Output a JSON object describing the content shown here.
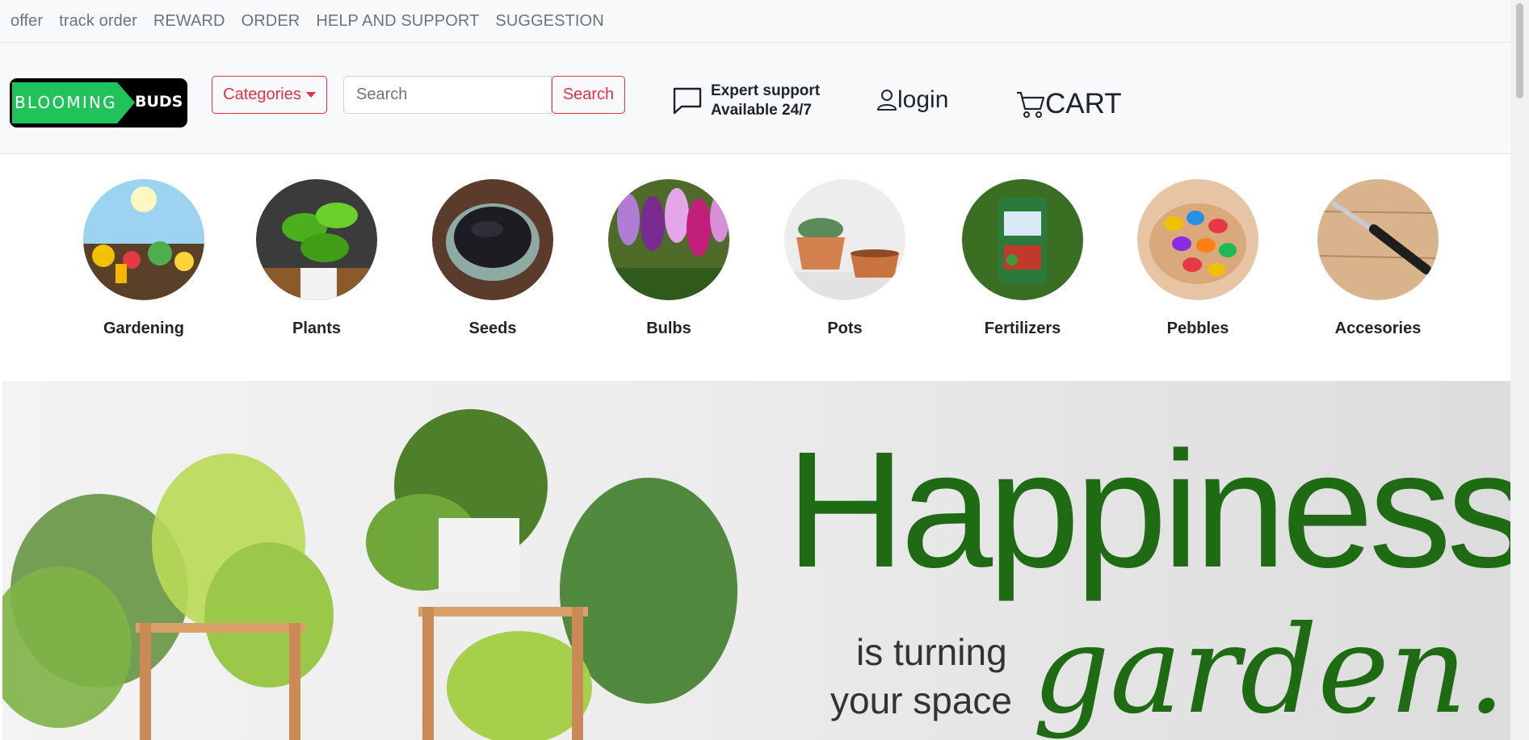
{
  "topnav": {
    "links": [
      "offer",
      "track order",
      "REWARD",
      "ORDER",
      "HELP AND SUPPORT",
      "SUGGESTION"
    ]
  },
  "logo": {
    "word1": "BLOOMING",
    "word2": "BUDS"
  },
  "header": {
    "categories_label": "Categories",
    "search_placeholder": "Search",
    "search_button": "Search",
    "support_line1": "Expert support",
    "support_line2": "Available 24/7",
    "login_label": "login",
    "cart_label": "CART"
  },
  "categories": [
    {
      "label": "Gardening"
    },
    {
      "label": "Plants"
    },
    {
      "label": "Seeds"
    },
    {
      "label": "Bulbs"
    },
    {
      "label": "Pots"
    },
    {
      "label": "Fertilizers"
    },
    {
      "label": "Pebbles"
    },
    {
      "label": "Accesories"
    }
  ],
  "banner": {
    "headline": "Happiness",
    "line1": "is turning",
    "line2": "your space",
    "script": "garden..."
  },
  "colors": {
    "accent": "#dc3545",
    "logo_green": "#20c35a",
    "banner_green": "#1e6b14"
  }
}
